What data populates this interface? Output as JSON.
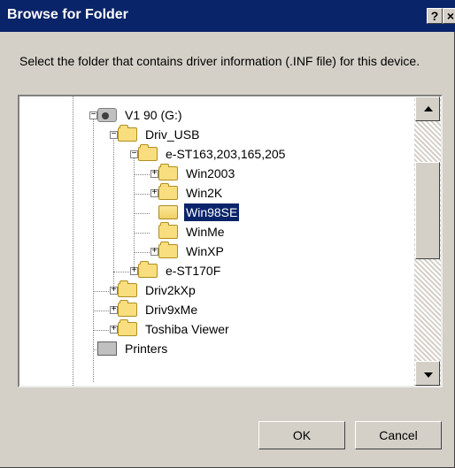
{
  "window": {
    "title": "Browse for Folder",
    "help_label": "?",
    "close_label": "×"
  },
  "prompt": "Select the folder that contains driver information (.INF file) for this device.",
  "tree": {
    "items": [
      {
        "label": "V1      90 (G:)",
        "icon": "drive",
        "selected": false
      },
      {
        "label": "Driv_USB",
        "icon": "folder",
        "selected": false
      },
      {
        "label": "e-ST163,203,165,205",
        "icon": "folder",
        "selected": false
      },
      {
        "label": "Win2003",
        "icon": "folder",
        "selected": false
      },
      {
        "label": "Win2K",
        "icon": "folder",
        "selected": false
      },
      {
        "label": "Win98SE",
        "icon": "open-folder",
        "selected": true
      },
      {
        "label": "WinMe",
        "icon": "folder",
        "selected": false
      },
      {
        "label": "WinXP",
        "icon": "folder",
        "selected": false
      },
      {
        "label": "e-ST170F",
        "icon": "folder",
        "selected": false
      },
      {
        "label": "Driv2kXp",
        "icon": "folder",
        "selected": false
      },
      {
        "label": "Driv9xMe",
        "icon": "folder",
        "selected": false
      },
      {
        "label": "Toshiba Viewer",
        "icon": "folder",
        "selected": false
      },
      {
        "label": "Printers",
        "icon": "printer",
        "selected": false
      }
    ]
  },
  "buttons": {
    "ok": "OK",
    "cancel": "Cancel"
  }
}
